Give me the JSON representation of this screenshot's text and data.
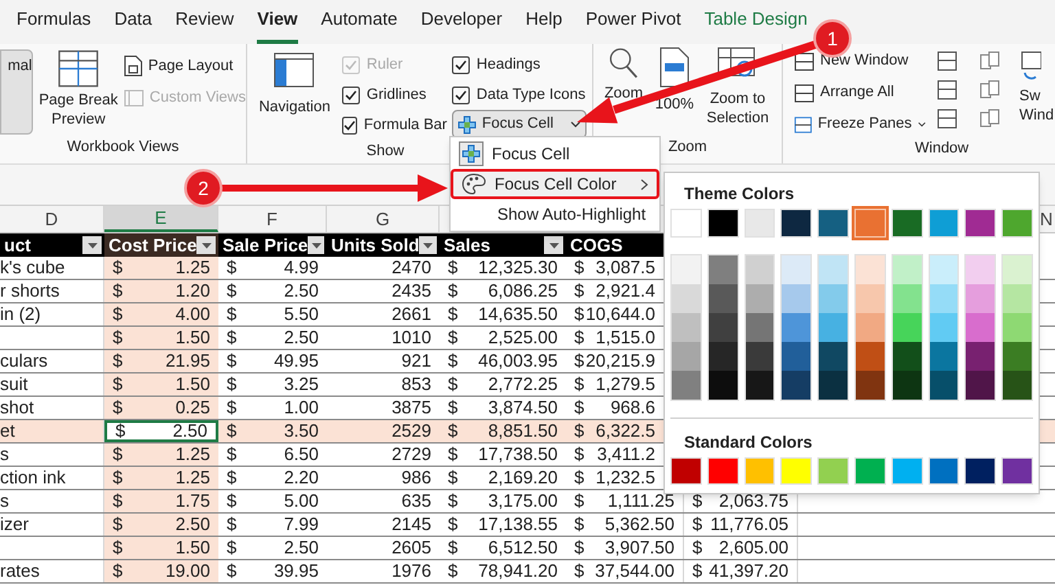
{
  "tabs": [
    {
      "label": "Formulas",
      "selected": false,
      "kind": "normal"
    },
    {
      "label": "Data",
      "selected": false,
      "kind": "normal"
    },
    {
      "label": "Review",
      "selected": false,
      "kind": "normal"
    },
    {
      "label": "View",
      "selected": true,
      "kind": "normal"
    },
    {
      "label": "Automate",
      "selected": false,
      "kind": "normal"
    },
    {
      "label": "Developer",
      "selected": false,
      "kind": "normal"
    },
    {
      "label": "Help",
      "selected": false,
      "kind": "normal"
    },
    {
      "label": "Power Pivot",
      "selected": false,
      "kind": "normal"
    },
    {
      "label": "Table Design",
      "selected": false,
      "kind": "contextual"
    }
  ],
  "ribbon": {
    "workbook_views": {
      "label": "Workbook Views",
      "normal": {
        "label": "mal",
        "selected": true
      },
      "page_break_preview": "Page Break Preview",
      "page_layout": "Page Layout",
      "custom_views": {
        "label": "Custom Views",
        "disabled": true
      }
    },
    "show": {
      "label": "Show",
      "navigation": "Navigation",
      "checks": [
        {
          "label": "Ruler",
          "checked": true,
          "disabled": true
        },
        {
          "label": "Gridlines",
          "checked": true,
          "disabled": false
        },
        {
          "label": "Formula Bar",
          "checked": true,
          "disabled": false
        },
        {
          "label": "Headings",
          "checked": true,
          "disabled": false
        },
        {
          "label": "Data Type Icons",
          "checked": true,
          "disabled": false
        }
      ],
      "focus_cell": {
        "label": "Focus Cell",
        "expanded": true
      }
    },
    "zoom": {
      "label": "Zoom",
      "zoom": "Zoom",
      "hundred": "100%",
      "zoom_to_selection": "Zoom to Selection"
    },
    "window": {
      "label": "Window",
      "new_window": "New Window",
      "arrange_all": "Arrange All",
      "freeze_panes": "Freeze Panes",
      "switch_windows": [
        "Sw",
        "Wind"
      ]
    }
  },
  "column_headers": [
    {
      "label": "D",
      "selected": false
    },
    {
      "label": "E",
      "selected": true
    },
    {
      "label": "F",
      "selected": false
    },
    {
      "label": "G",
      "selected": false
    }
  ],
  "column_header_right": "N",
  "table": {
    "columns": [
      {
        "label": "uct",
        "filter": true
      },
      {
        "label": "Cost Price",
        "filter": true
      },
      {
        "label": "Sale Price",
        "filter": true
      },
      {
        "label": "Units Sold",
        "filter": true
      },
      {
        "label": "Sales",
        "filter": true
      },
      {
        "label": "COGS",
        "filter": false
      }
    ],
    "rows": [
      {
        "selected": false,
        "product": "k's cube",
        "cost": [
          "$",
          "1.25"
        ],
        "sale": [
          "$",
          "4.99"
        ],
        "units": "2470",
        "sales": [
          "$",
          "12,325.30"
        ],
        "cogs": [
          "$",
          "3,087.5"
        ]
      },
      {
        "selected": false,
        "product": "r shorts",
        "cost": [
          "$",
          "1.20"
        ],
        "sale": [
          "$",
          "2.50"
        ],
        "units": "2435",
        "sales": [
          "$",
          "6,086.25"
        ],
        "cogs": [
          "$",
          "2,921.4"
        ]
      },
      {
        "selected": false,
        "product": "in (2)",
        "cost": [
          "$",
          "4.00"
        ],
        "sale": [
          "$",
          "5.50"
        ],
        "units": "2661",
        "sales": [
          "$",
          "14,635.50"
        ],
        "cogs": [
          "$",
          "10,644.0"
        ]
      },
      {
        "selected": false,
        "cost": [
          "$",
          "1.50"
        ],
        "sale": [
          "$",
          "2.50"
        ],
        "units": "1010",
        "sales": [
          "$",
          "2,525.00"
        ],
        "cogs": [
          "$",
          "1,515.0"
        ]
      },
      {
        "selected": false,
        "product": "culars",
        "cost": [
          "$",
          "21.95"
        ],
        "sale": [
          "$",
          "49.95"
        ],
        "units": "921",
        "sales": [
          "$",
          "46,003.95"
        ],
        "cogs": [
          "$",
          "20,215.9"
        ]
      },
      {
        "selected": false,
        "product": "suit",
        "cost": [
          "$",
          "1.50"
        ],
        "sale": [
          "$",
          "3.25"
        ],
        "units": "853",
        "sales": [
          "$",
          "2,772.25"
        ],
        "cogs": [
          "$",
          "1,279.5"
        ]
      },
      {
        "selected": false,
        "product": "shot",
        "cost": [
          "$",
          "0.25"
        ],
        "sale": [
          "$",
          "1.00"
        ],
        "units": "3875",
        "sales": [
          "$",
          "3,874.50"
        ],
        "cogs": [
          "$",
          "968.6"
        ]
      },
      {
        "selected": true,
        "product": "et",
        "cost": [
          "$",
          "2.50"
        ],
        "sale": [
          "$",
          "3.50"
        ],
        "units": "2529",
        "sales": [
          "$",
          "8,851.50"
        ],
        "cogs": [
          "$",
          "6,322.5"
        ]
      },
      {
        "selected": false,
        "product": "s",
        "cost": [
          "$",
          "1.25"
        ],
        "sale": [
          "$",
          "6.50"
        ],
        "units": "2729",
        "sales": [
          "$",
          "17,738.50"
        ],
        "cogs": [
          "$",
          "3,411.2"
        ]
      },
      {
        "selected": false,
        "product": "ction ink",
        "cost": [
          "$",
          "1.25"
        ],
        "sale": [
          "$",
          "2.20"
        ],
        "units": "986",
        "sales": [
          "$",
          "2,169.20"
        ],
        "cogs": [
          "$",
          "1,232.5"
        ]
      },
      {
        "selected": false,
        "product": "s",
        "cost": [
          "$",
          "1.75"
        ],
        "sale": [
          "$",
          "5.00"
        ],
        "units": "635",
        "sales": [
          "$",
          "3,175.00"
        ],
        "cogs": [
          "$",
          "1,111.25"
        ],
        "column_7": [
          "$",
          "2,063.75"
        ]
      },
      {
        "selected": false,
        "product": "izer",
        "cost": [
          "$",
          "2.50"
        ],
        "sale": [
          "$",
          "7.99"
        ],
        "units": "2145",
        "sales": [
          "$",
          "17,138.55"
        ],
        "cogs": [
          "$",
          "5,362.50"
        ],
        "column_7": [
          "$",
          "11,776.05"
        ]
      },
      {
        "selected": false,
        "cost": [
          "$",
          "1.50"
        ],
        "sale": [
          "$",
          "2.50"
        ],
        "units": "2605",
        "sales": [
          "$",
          "6,512.50"
        ],
        "cogs": [
          "$",
          "3,907.50"
        ],
        "column_7": [
          "$",
          "2,605.00"
        ]
      },
      {
        "selected": false,
        "product": "rates",
        "cost": [
          "$",
          "19.00"
        ],
        "sale": [
          "$",
          "39.95"
        ],
        "units": "1976",
        "sales": [
          "$",
          "78,941.20"
        ],
        "cogs": [
          "$",
          "37,544.00"
        ],
        "column_7": [
          "$",
          "41,397.20"
        ]
      }
    ]
  },
  "focus_menu": {
    "items": [
      {
        "label": "Focus Cell",
        "kind": "toggle",
        "annotated": false
      },
      {
        "label": "Focus Cell Color",
        "kind": "submenu",
        "annotated": true
      },
      {
        "label": "Show Auto-Highlight",
        "kind": "plain",
        "annotated": false
      }
    ]
  },
  "color_palette": {
    "theme_title": "Theme Colors",
    "theme": [
      {
        "color": "#ffffff",
        "selected": false
      },
      {
        "color": "#000000",
        "selected": false
      },
      {
        "color": "#e8e8e8",
        "selected": false
      },
      {
        "color": "#0e2841",
        "selected": false
      },
      {
        "color": "#156082",
        "selected": false
      },
      {
        "color": "#e97132",
        "selected": true
      },
      {
        "color": "#196b24",
        "selected": false
      },
      {
        "color": "#0f9ed5",
        "selected": false
      },
      {
        "color": "#a02b93",
        "selected": false
      },
      {
        "color": "#4ea72e",
        "selected": false
      }
    ],
    "shade_columns": [
      {
        "shades": [
          {
            "color": "#f2f2f2"
          },
          {
            "color": "#d9d9d9"
          },
          {
            "color": "#bfbfbf"
          },
          {
            "color": "#a6a6a6"
          },
          {
            "color": "#808080"
          }
        ]
      },
      {
        "shades": [
          {
            "color": "#7f7f7f"
          },
          {
            "color": "#595959"
          },
          {
            "color": "#404040"
          },
          {
            "color": "#262626"
          },
          {
            "color": "#0d0d0d"
          }
        ]
      },
      {
        "shades": [
          {
            "color": "#d0d0d0"
          },
          {
            "color": "#adadad"
          },
          {
            "color": "#757575"
          },
          {
            "color": "#3a3a3a"
          },
          {
            "color": "#171717"
          }
        ]
      },
      {
        "shades": [
          {
            "color": "#dceaf7"
          },
          {
            "color": "#a6c9ec"
          },
          {
            "color": "#4e95d9"
          },
          {
            "color": "#215f9a"
          },
          {
            "color": "#153d64"
          }
        ]
      },
      {
        "shades": [
          {
            "color": "#c0e4f5"
          },
          {
            "color": "#83cbeb"
          },
          {
            "color": "#47b1e2"
          },
          {
            "color": "#104862"
          },
          {
            "color": "#0b3041"
          }
        ]
      },
      {
        "shades": [
          {
            "color": "#fbe2d5"
          },
          {
            "color": "#f7c7ac"
          },
          {
            "color": "#f1a983"
          },
          {
            "color": "#c04f15"
          },
          {
            "color": "#803410"
          }
        ]
      },
      {
        "shades": [
          {
            "color": "#c1f0c8"
          },
          {
            "color": "#83e28e"
          },
          {
            "color": "#47d45a"
          },
          {
            "color": "#124f1a"
          },
          {
            "color": "#0d3512"
          }
        ]
      },
      {
        "shades": [
          {
            "color": "#caeefb"
          },
          {
            "color": "#95dcf7"
          },
          {
            "color": "#61cbf3"
          },
          {
            "color": "#0b76a0"
          },
          {
            "color": "#074f6a"
          }
        ]
      },
      {
        "shades": [
          {
            "color": "#f2ceef"
          },
          {
            "color": "#e59edd"
          },
          {
            "color": "#d86dcd"
          },
          {
            "color": "#782170"
          },
          {
            "color": "#501549"
          }
        ]
      },
      {
        "shades": [
          {
            "color": "#daf2d0"
          },
          {
            "color": "#b5e6a2"
          },
          {
            "color": "#8ed973"
          },
          {
            "color": "#3b7d23"
          },
          {
            "color": "#275317"
          }
        ]
      }
    ],
    "standard_title": "Standard Colors",
    "standard": [
      {
        "color": "#c00000"
      },
      {
        "color": "#ff0000"
      },
      {
        "color": "#ffc000"
      },
      {
        "color": "#ffff00"
      },
      {
        "color": "#92d050"
      },
      {
        "color": "#00b050"
      },
      {
        "color": "#00b0f0"
      },
      {
        "color": "#0070c0"
      },
      {
        "color": "#002060"
      },
      {
        "color": "#7030a0"
      }
    ]
  },
  "annotations": [
    {
      "label": "1"
    },
    {
      "label": "2"
    }
  ]
}
